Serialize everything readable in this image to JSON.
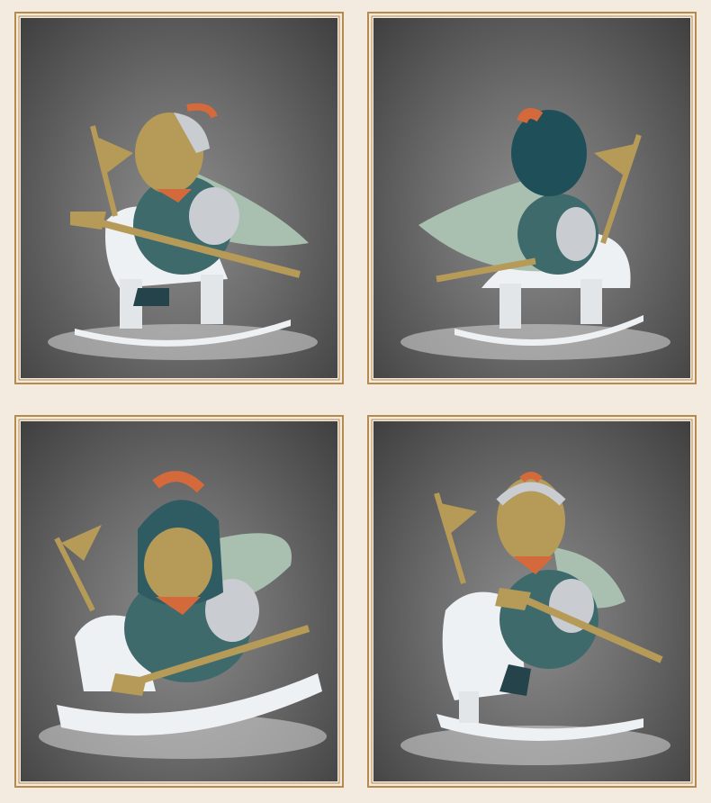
{
  "gallery": {
    "panels": [
      {
        "view": "front-left"
      },
      {
        "view": "back-right"
      },
      {
        "view": "front-low"
      },
      {
        "view": "front-right"
      }
    ]
  },
  "colors": {
    "page_bg": "#f3ebe0",
    "frame_gold": "#b58a4a",
    "backdrop_dark": "#3f3f3f",
    "backdrop_light": "#8c8c8c",
    "figure_teal": "#3f6a6c",
    "figure_celadon": "#a9c0b1",
    "armor_silver": "#c9ccd1",
    "face_gold": "#b69a58",
    "plume_orange": "#d46a3c",
    "horse_white": "#eef1f3"
  }
}
